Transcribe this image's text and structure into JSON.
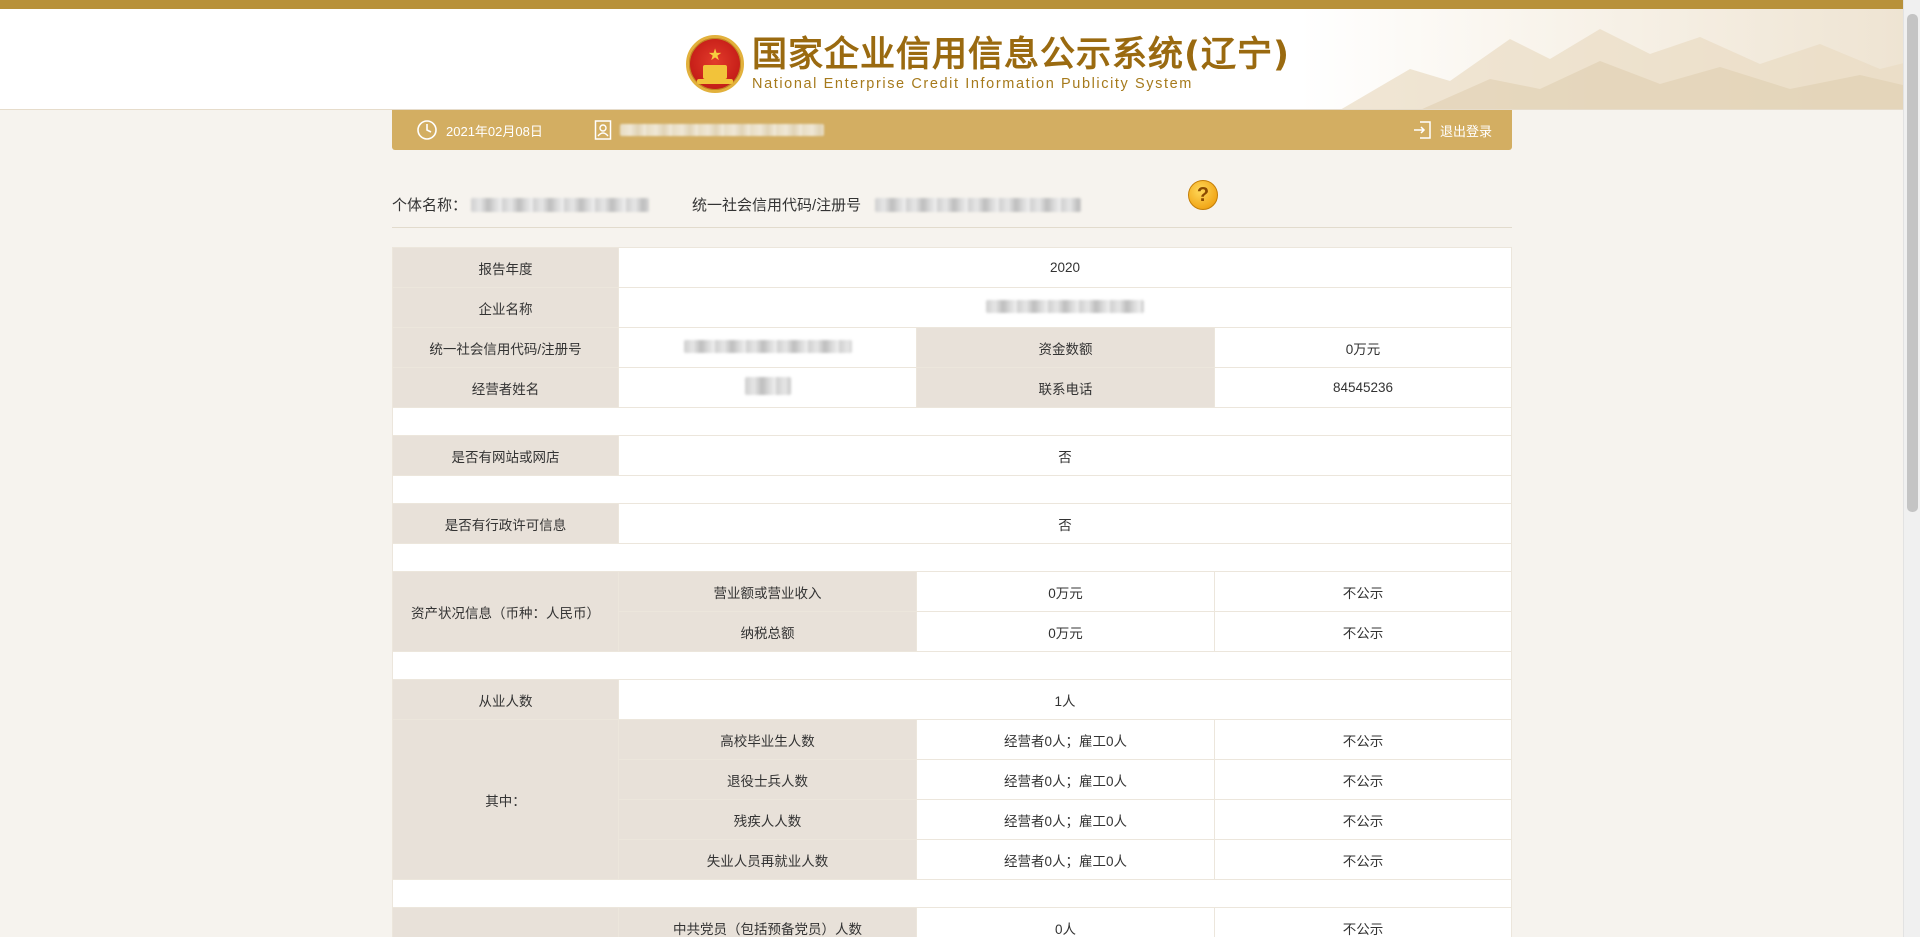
{
  "header": {
    "title_cn": "国家企业信用信息公示系统(辽宁)",
    "title_en": "National Enterprise Credit Information Publicity System"
  },
  "userbar": {
    "date": "2021年02月08日",
    "logout_label": "退出登录"
  },
  "info": {
    "name_label": "个体名称：",
    "code_label": "统一社会信用代码/注册号",
    "help_label": "?"
  },
  "report": {
    "year_label": "报告年度",
    "year_value": "2020",
    "company_label": "企业名称",
    "code_label": "统一社会信用代码/注册号",
    "capital_label": "资金数额",
    "capital_value": "0万元",
    "operator_label": "经营者姓名",
    "phone_label": "联系电话",
    "phone_value": "84545236",
    "website_label": "是否有网站或网店",
    "website_value": "否",
    "license_label": "是否有行政许可信息",
    "license_value": "否",
    "assets_label": "资产状况信息（币种：人民币）",
    "revenue_label": "营业额或营业收入",
    "revenue_value": "0万元",
    "revenue_public": "不公示",
    "tax_label": "纳税总额",
    "tax_value": "0万元",
    "tax_public": "不公示",
    "employees_label": "从业人数",
    "employees_value": "1人",
    "among_label": "其中：",
    "sub_rows": [
      {
        "label": "高校毕业生人数",
        "value": "经营者0人；雇工0人",
        "public": "不公示"
      },
      {
        "label": "退役士兵人数",
        "value": "经营者0人；雇工0人",
        "public": "不公示"
      },
      {
        "label": "残疾人人数",
        "value": "经营者0人；雇工0人",
        "public": "不公示"
      },
      {
        "label": "失业人员再就业人数",
        "value": "经营者0人；雇工0人",
        "public": "不公示"
      }
    ],
    "party_label": "中共党员（包括预备党员）人数",
    "party_value": "0人",
    "party_public": "不公示"
  }
}
